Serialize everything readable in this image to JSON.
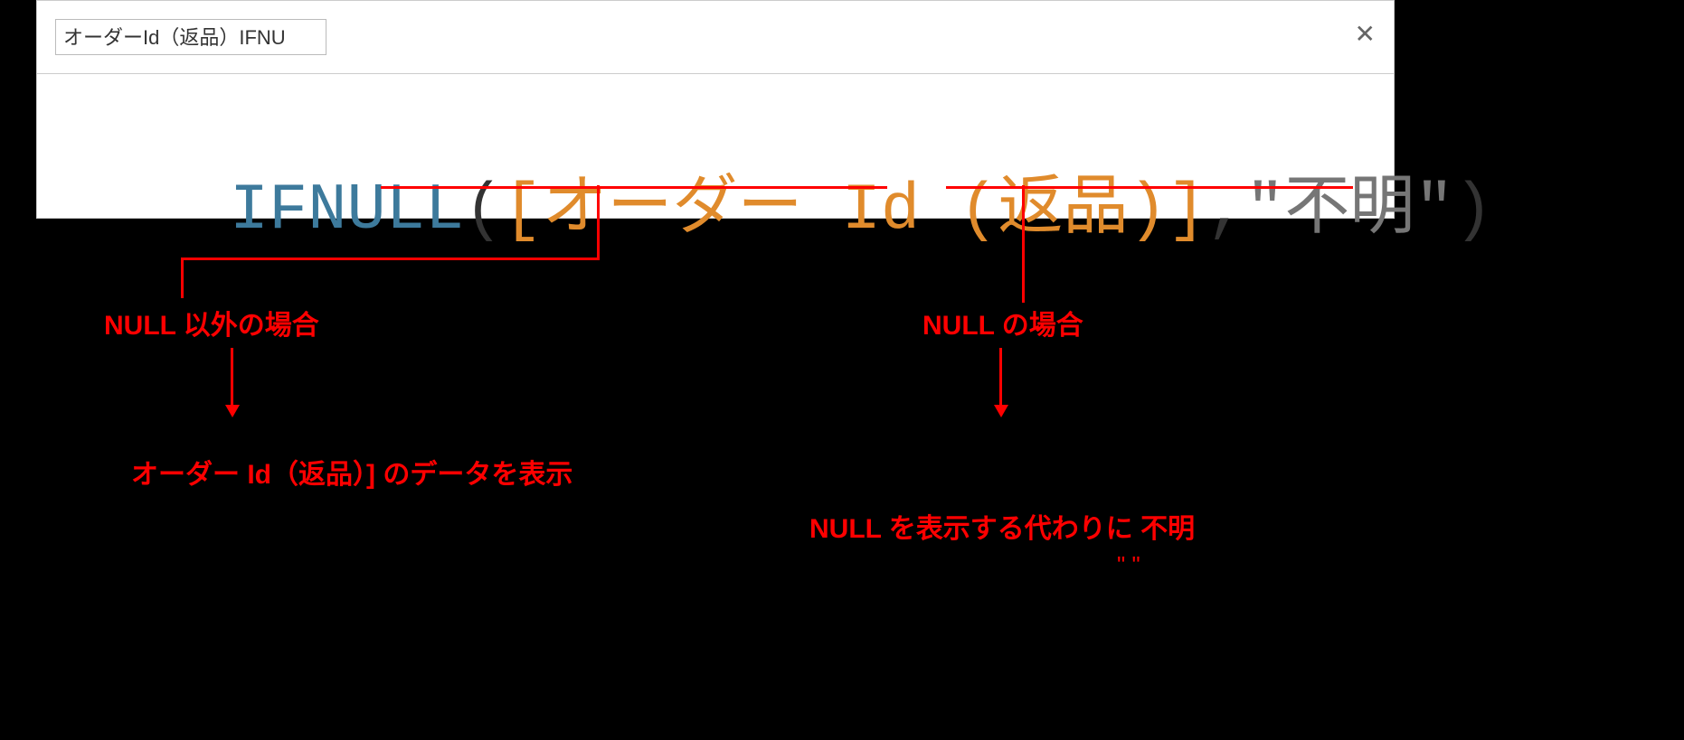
{
  "editor": {
    "title": "オーダーId（返品）IFNU",
    "close_glyph": "✕"
  },
  "formula": {
    "function": "IFNULL",
    "open_paren": "(",
    "field_open": "[",
    "field_name": "オーダー Id (返品)",
    "field_close": "]",
    "comma": ",",
    "string": "\"不明\"",
    "close_paren": ")"
  },
  "annotations": {
    "left_label": "NULL 以外の場合",
    "left_result": "オーダー Id（返品）] のデータを表示",
    "right_label": "NULL の場合",
    "right_result": "NULL を表示する代わりに 不明",
    "quote_marks": "\" \""
  }
}
